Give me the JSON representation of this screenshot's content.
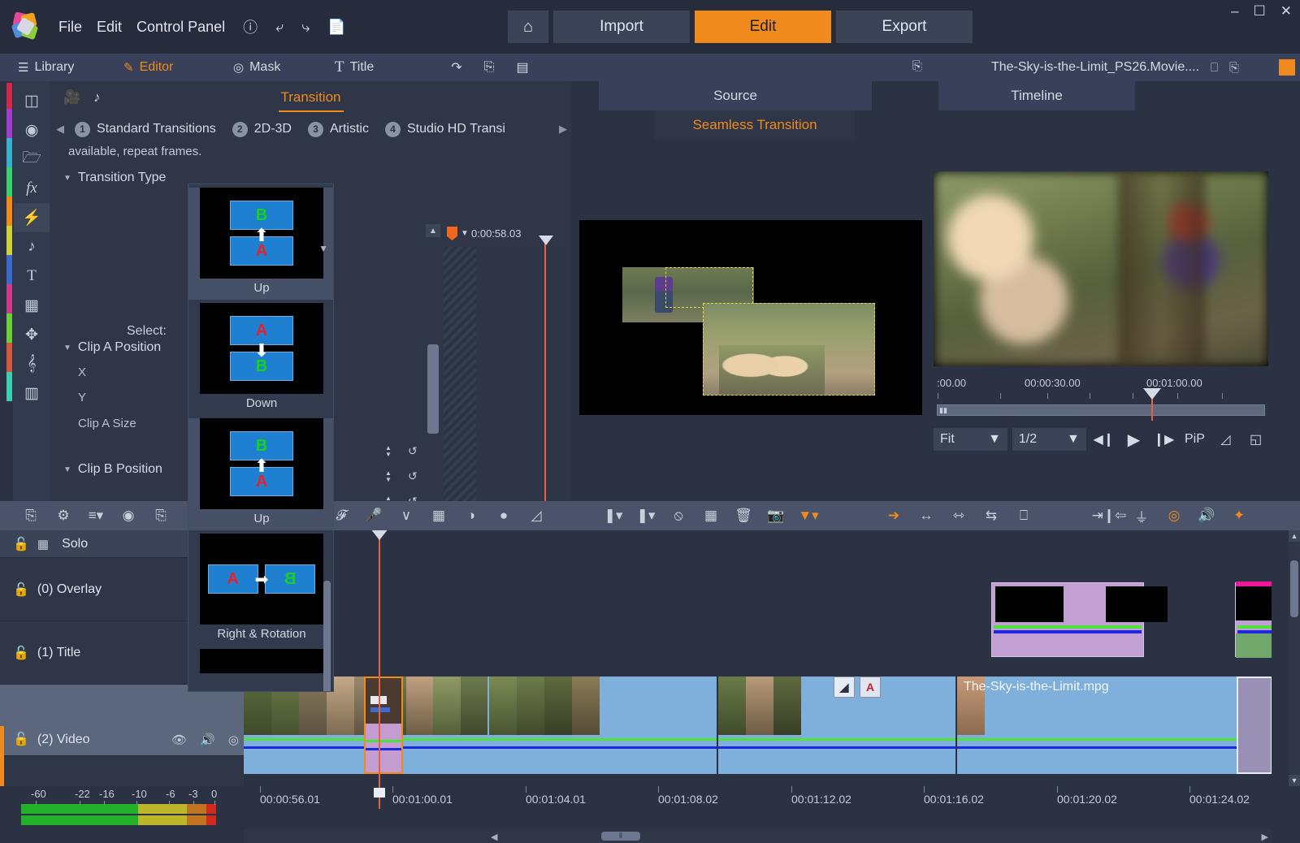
{
  "titlebar": {
    "menus": [
      "File",
      "Edit",
      "Control Panel"
    ],
    "icons": [
      "help-icon",
      "undo-icon",
      "redo-icon",
      "document-icon"
    ],
    "home_label": "⌂",
    "buttons": [
      {
        "label": "Import",
        "active": false
      },
      {
        "label": "Edit",
        "active": true
      },
      {
        "label": "Export",
        "active": false
      }
    ],
    "window_controls": [
      "minimize",
      "maximize",
      "close"
    ]
  },
  "tabbar": {
    "tabs": [
      {
        "label": "Library",
        "icon": "library-icon",
        "active": false
      },
      {
        "label": "Editor",
        "icon": "editor-pencil-icon",
        "active": true
      },
      {
        "label": "Mask",
        "icon": "mask-icon",
        "active": false
      },
      {
        "label": "Title",
        "icon": "title-T-icon",
        "active": false
      }
    ],
    "right_icons": [
      "swap-icon",
      "popout-icon",
      "split-view-icon"
    ]
  },
  "icon_rail": {
    "items": [
      {
        "name": "media-box-icon",
        "selected": false
      },
      {
        "name": "film-reel-icon",
        "selected": false
      },
      {
        "name": "folders-icon",
        "selected": false
      },
      {
        "name": "fx-icon",
        "selected": false
      },
      {
        "name": "transitions-lightning-icon",
        "selected": true
      },
      {
        "name": "music-note-icon",
        "selected": false
      },
      {
        "name": "title-text-icon",
        "selected": false
      },
      {
        "name": "overlay-icon",
        "selected": false
      },
      {
        "name": "layers-icon",
        "selected": false
      },
      {
        "name": "treble-clef-icon",
        "selected": false
      },
      {
        "name": "piano-keys-icon",
        "selected": false
      }
    ]
  },
  "editor": {
    "panel_title": "Transition",
    "header_icons": [
      "video-camera-icon",
      "audio-note-icon"
    ],
    "categories": [
      {
        "num": "1",
        "label": "Standard Transitions"
      },
      {
        "num": "2",
        "label": "2D-3D"
      },
      {
        "num": "3",
        "label": "Artistic"
      },
      {
        "num": "4",
        "label": "Studio HD Transi"
      }
    ],
    "help_text": "available, repeat frames.",
    "sections": [
      {
        "label": "Transition Type",
        "expanded": true
      },
      {
        "label": "Clip A Position",
        "expanded": true
      },
      {
        "label": "Clip B Position",
        "expanded": true
      }
    ],
    "select_label": "Select:",
    "properties": [
      "X",
      "Y",
      "Clip A Size"
    ],
    "keyframe": {
      "timecode": "0:00:58.03"
    }
  },
  "transition_dropdown": {
    "items": [
      {
        "label": "Up",
        "top": "B",
        "bottom": "A",
        "arrow": "up",
        "selected": true
      },
      {
        "label": "Down",
        "top": "A",
        "bottom": "B",
        "arrow": "down",
        "selected": false
      },
      {
        "label": "Up",
        "top": "B",
        "bottom": "A",
        "arrow": "up",
        "selected": true
      },
      {
        "label": "Right & Rotation",
        "left": "A",
        "right": "B",
        "arrow": "right",
        "selected": false
      }
    ]
  },
  "preview": {
    "tab_source": "Source",
    "tab_seamless": "Seamless Transition",
    "expand_icon": "popout-icon"
  },
  "timeline_preview": {
    "project_name": "The-Sky-is-the-Limit_PS26.Movie....",
    "tab_label": "Timeline",
    "header_icons": [
      "fullscreen-icon",
      "popout-icon",
      "record-icon"
    ],
    "scrub_ticks": [
      ":00.00",
      "00:00:30.00",
      "00:01:00.00"
    ],
    "transport": {
      "fit_value": "Fit",
      "speed_value": "1/2",
      "prev_frame": "prev-frame-icon",
      "play": "play-icon",
      "next_frame": "next-frame-icon",
      "pip_label": "PiP",
      "crop_icon": "crop-icon",
      "fullscreen_icon": "fullscreen-icon"
    }
  },
  "timeline_toolbar": {
    "left_icons": [
      "timeline-settings-icon",
      "gear-icon",
      "track-height-icon",
      "disc-icon",
      "popout-icon"
    ],
    "mid_icons": [
      "title-3d-icon",
      "voiceover-mic-icon",
      "audio-curve-icon",
      "storyboard-grid-icon",
      "audio-mixer-icon",
      "overlay-bubbles-icon",
      "chroma-key-icon"
    ],
    "mark_icons": [
      "mark-in-icon",
      "mark-out-icon",
      "clear-marks-icon",
      "crop-icon",
      "delete-trash-icon",
      "snapshot-camera-icon",
      "marker-flag-icon"
    ],
    "right_icons": [
      "pointer-tool-icon",
      "trim-both-icon",
      "slip-tool-icon",
      "slide-tool-icon",
      "smart-edit-icon",
      "split-clip-icon",
      "transition-ramp-icon",
      "magnet-snap-icon",
      "audio-scrub-icon",
      "magic-wand-icon"
    ]
  },
  "tracks": [
    {
      "label": "Solo",
      "type": "solo-row",
      "icons": [
        "lock-icon",
        "add-track-icon",
        "eye-icon",
        "speaker-icon"
      ]
    },
    {
      "label": "(0) Overlay",
      "icons": [
        "lock-icon",
        "eye-icon",
        "speaker-icon"
      ]
    },
    {
      "label": "(1) Title",
      "icons": [
        "lock-icon",
        "eye-icon",
        "speaker-icon"
      ]
    },
    {
      "label": "(2) Video",
      "icons": [
        "lock-icon",
        "eye-icon",
        "speaker-icon",
        "mask-icon"
      ],
      "selected": true
    }
  ],
  "timeline": {
    "clip_label": "The-Sky-is-the-Limit.mpg",
    "ruler_labels": [
      "00:00:56.01",
      "00:01:00.01",
      "00:01:04.01",
      "00:01:08.02",
      "00:01:12.02",
      "00:01:16.02",
      "00:01:20.02",
      "00:01:24.02"
    ],
    "transition_marker": "A",
    "scroll_grip": "⦀"
  },
  "audio_meter": {
    "scale": [
      "-60",
      "-22",
      "-16",
      "-10",
      "-6",
      "-3",
      "0"
    ]
  },
  "colors": {
    "accent": "#f08a1c",
    "panel": "#2f3648",
    "bar": "#39415a",
    "playhead": "#e8603c",
    "clip_video": "#7fb0dc",
    "clip_title": "#c2a0d4"
  }
}
